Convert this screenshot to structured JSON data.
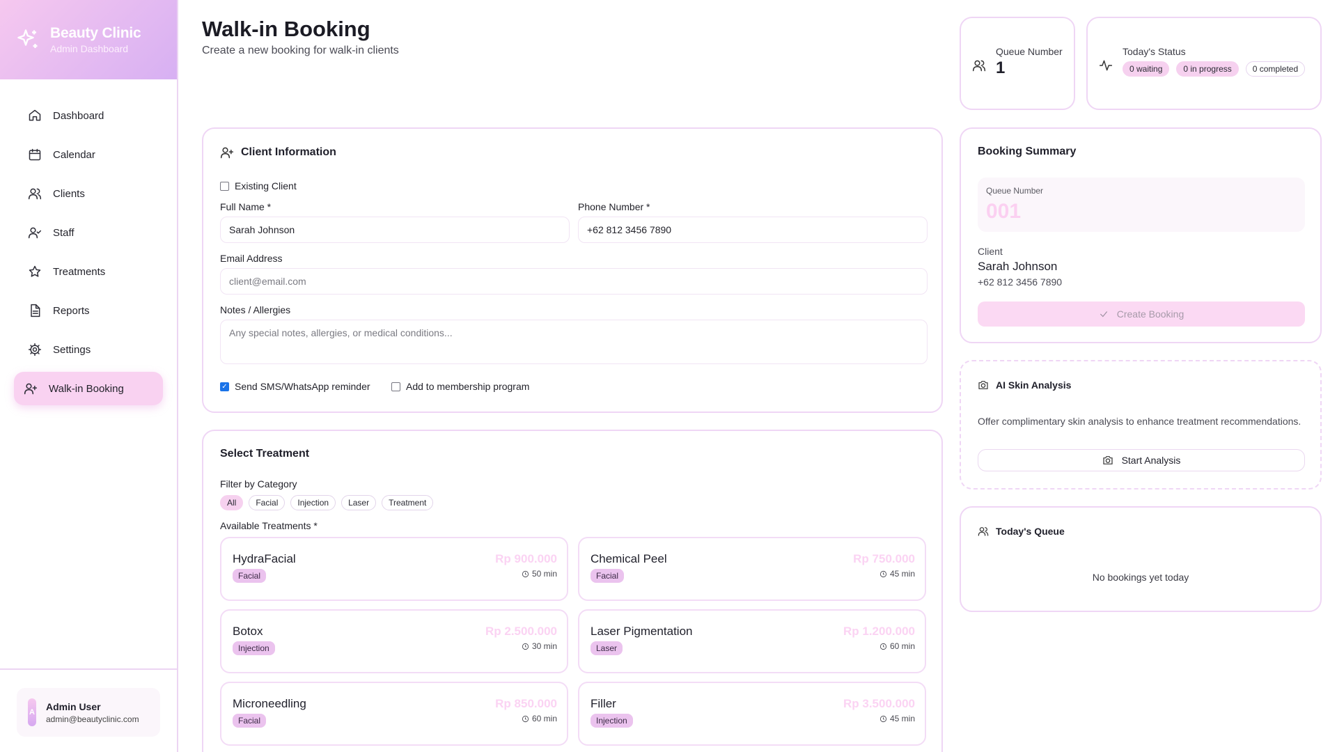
{
  "brand": {
    "title": "Beauty Clinic",
    "subtitle": "Admin Dashboard"
  },
  "nav": [
    {
      "label": "Dashboard",
      "icon": "home-icon"
    },
    {
      "label": "Calendar",
      "icon": "calendar-icon"
    },
    {
      "label": "Clients",
      "icon": "users-icon"
    },
    {
      "label": "Staff",
      "icon": "staff-icon"
    },
    {
      "label": "Treatments",
      "icon": "star-icon"
    },
    {
      "label": "Reports",
      "icon": "file-icon"
    },
    {
      "label": "Settings",
      "icon": "gear-icon"
    },
    {
      "label": "Walk-in Booking",
      "icon": "user-plus-icon",
      "active": true
    }
  ],
  "user": {
    "initial": "A",
    "name": "Admin User",
    "email": "admin@beautyclinic.com"
  },
  "header": {
    "title": "Walk-in Booking",
    "subtitle": "Create a new booking for walk-in clients"
  },
  "stats": {
    "queue_label": "Queue Number",
    "queue_value": "1",
    "status_label": "Today's Status",
    "waiting": "0 waiting",
    "in_progress": "0 in progress",
    "completed": "0 completed"
  },
  "client": {
    "title": "Client Information",
    "existing_label": "Existing Client",
    "existing_checked": false,
    "full_name_label": "Full Name *",
    "full_name_value": "Sarah Johnson",
    "phone_label": "Phone Number *",
    "phone_value": "+62 812 3456 7890",
    "email_label": "Email Address",
    "email_placeholder": "client@email.com",
    "notes_label": "Notes / Allergies",
    "notes_placeholder": "Any special notes, allergies, or medical conditions...",
    "sms_label": "Send SMS/WhatsApp reminder",
    "sms_checked": true,
    "membership_label": "Add to membership program",
    "membership_checked": false
  },
  "treatment": {
    "title": "Select Treatment",
    "filter_label": "Filter by Category",
    "categories": [
      "All",
      "Facial",
      "Injection",
      "Laser",
      "Treatment"
    ],
    "active_category": "All",
    "available_label": "Available Treatments *",
    "items": [
      {
        "name": "HydraFacial",
        "category": "Facial",
        "price": "Rp 900.000",
        "duration": "50 min"
      },
      {
        "name": "Chemical Peel",
        "category": "Facial",
        "price": "Rp 750.000",
        "duration": "45 min"
      },
      {
        "name": "Botox",
        "category": "Injection",
        "price": "Rp 2.500.000",
        "duration": "30 min"
      },
      {
        "name": "Laser Pigmentation",
        "category": "Laser",
        "price": "Rp 1.200.000",
        "duration": "60 min"
      },
      {
        "name": "Microneedling",
        "category": "Facial",
        "price": "Rp 850.000",
        "duration": "60 min"
      },
      {
        "name": "Filler",
        "category": "Injection",
        "price": "Rp 3.500.000",
        "duration": "45 min"
      }
    ]
  },
  "summary": {
    "title": "Booking Summary",
    "queue_label": "Queue Number",
    "queue_value": "001",
    "client_label": "Client",
    "client_name": "Sarah Johnson",
    "client_phone": "+62 812 3456 7890",
    "create_label": "Create Booking"
  },
  "skin": {
    "title": "AI Skin Analysis",
    "description": "Offer complimentary skin analysis to enhance treatment recommendations.",
    "button_label": "Start Analysis"
  },
  "queue": {
    "title": "Today's Queue",
    "empty_text": "No bookings yet today"
  },
  "colors": {
    "accent": "#f6d1ef",
    "brand_gradient_start": "#f6c8ef",
    "brand_gradient_end": "#d7b0f3",
    "price": "#fbd3f3",
    "tag": "#ebc3ee"
  }
}
